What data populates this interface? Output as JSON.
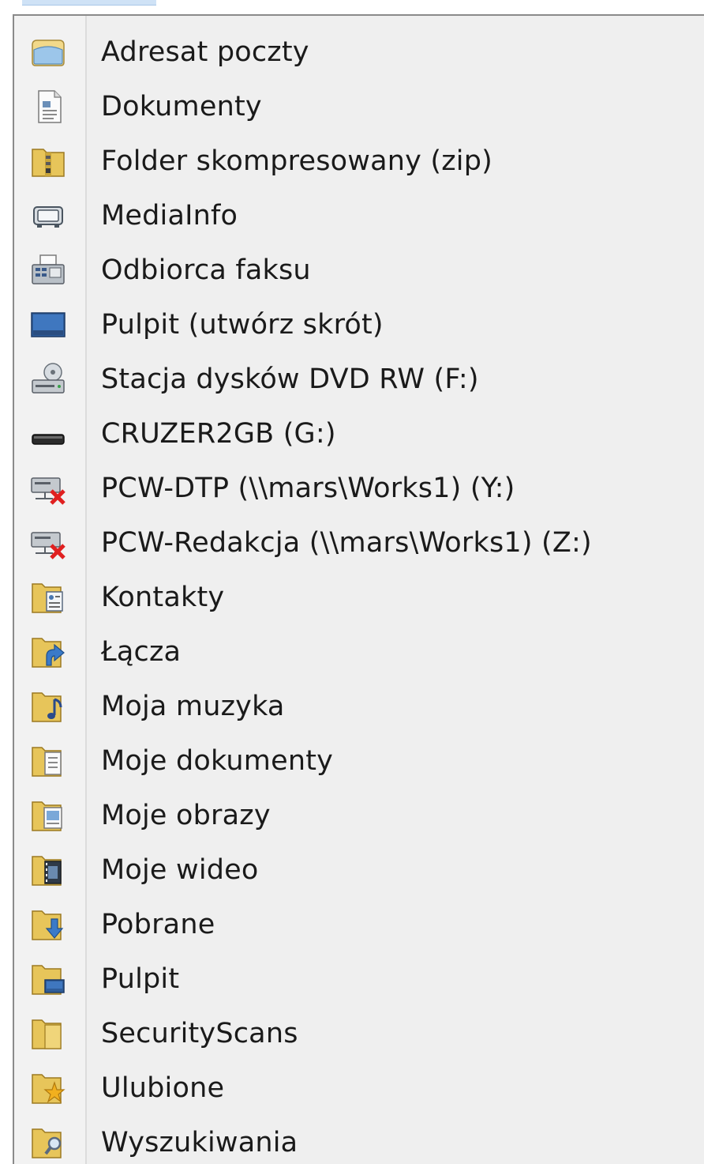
{
  "send_to_menu": {
    "items": [
      {
        "label": "Adresat poczty",
        "icon": "mail-recipient-icon"
      },
      {
        "label": "Dokumenty",
        "icon": "document-icon"
      },
      {
        "label": "Folder skompresowany (zip)",
        "icon": "zip-folder-icon"
      },
      {
        "label": "MediaInfo",
        "icon": "mediainfo-icon"
      },
      {
        "label": "Odbiorca faksu",
        "icon": "fax-icon"
      },
      {
        "label": "Pulpit (utwórz skrót)",
        "icon": "desktop-icon"
      },
      {
        "label": "Stacja dysków DVD RW (F:)",
        "icon": "dvd-drive-icon"
      },
      {
        "label": "CRUZER2GB (G:)",
        "icon": "usb-drive-icon"
      },
      {
        "label": "PCW-DTP (\\\\mars\\Works1) (Y:)",
        "icon": "disconnected-network-drive-icon"
      },
      {
        "label": "PCW-Redakcja (\\\\mars\\Works1) (Z:)",
        "icon": "disconnected-network-drive-icon"
      },
      {
        "label": "Kontakty",
        "icon": "contacts-folder-icon"
      },
      {
        "label": "Łącza",
        "icon": "links-folder-icon"
      },
      {
        "label": "Moja muzyka",
        "icon": "music-folder-icon"
      },
      {
        "label": "Moje dokumenty",
        "icon": "documents-folder-icon"
      },
      {
        "label": "Moje obrazy",
        "icon": "pictures-folder-icon"
      },
      {
        "label": "Moje wideo",
        "icon": "videos-folder-icon"
      },
      {
        "label": "Pobrane",
        "icon": "downloads-folder-icon"
      },
      {
        "label": "Pulpit",
        "icon": "desktop-folder-icon"
      },
      {
        "label": "SecurityScans",
        "icon": "folder-icon"
      },
      {
        "label": "Ulubione",
        "icon": "favorites-folder-icon"
      },
      {
        "label": "Wyszukiwania",
        "icon": "searches-folder-icon"
      }
    ]
  }
}
